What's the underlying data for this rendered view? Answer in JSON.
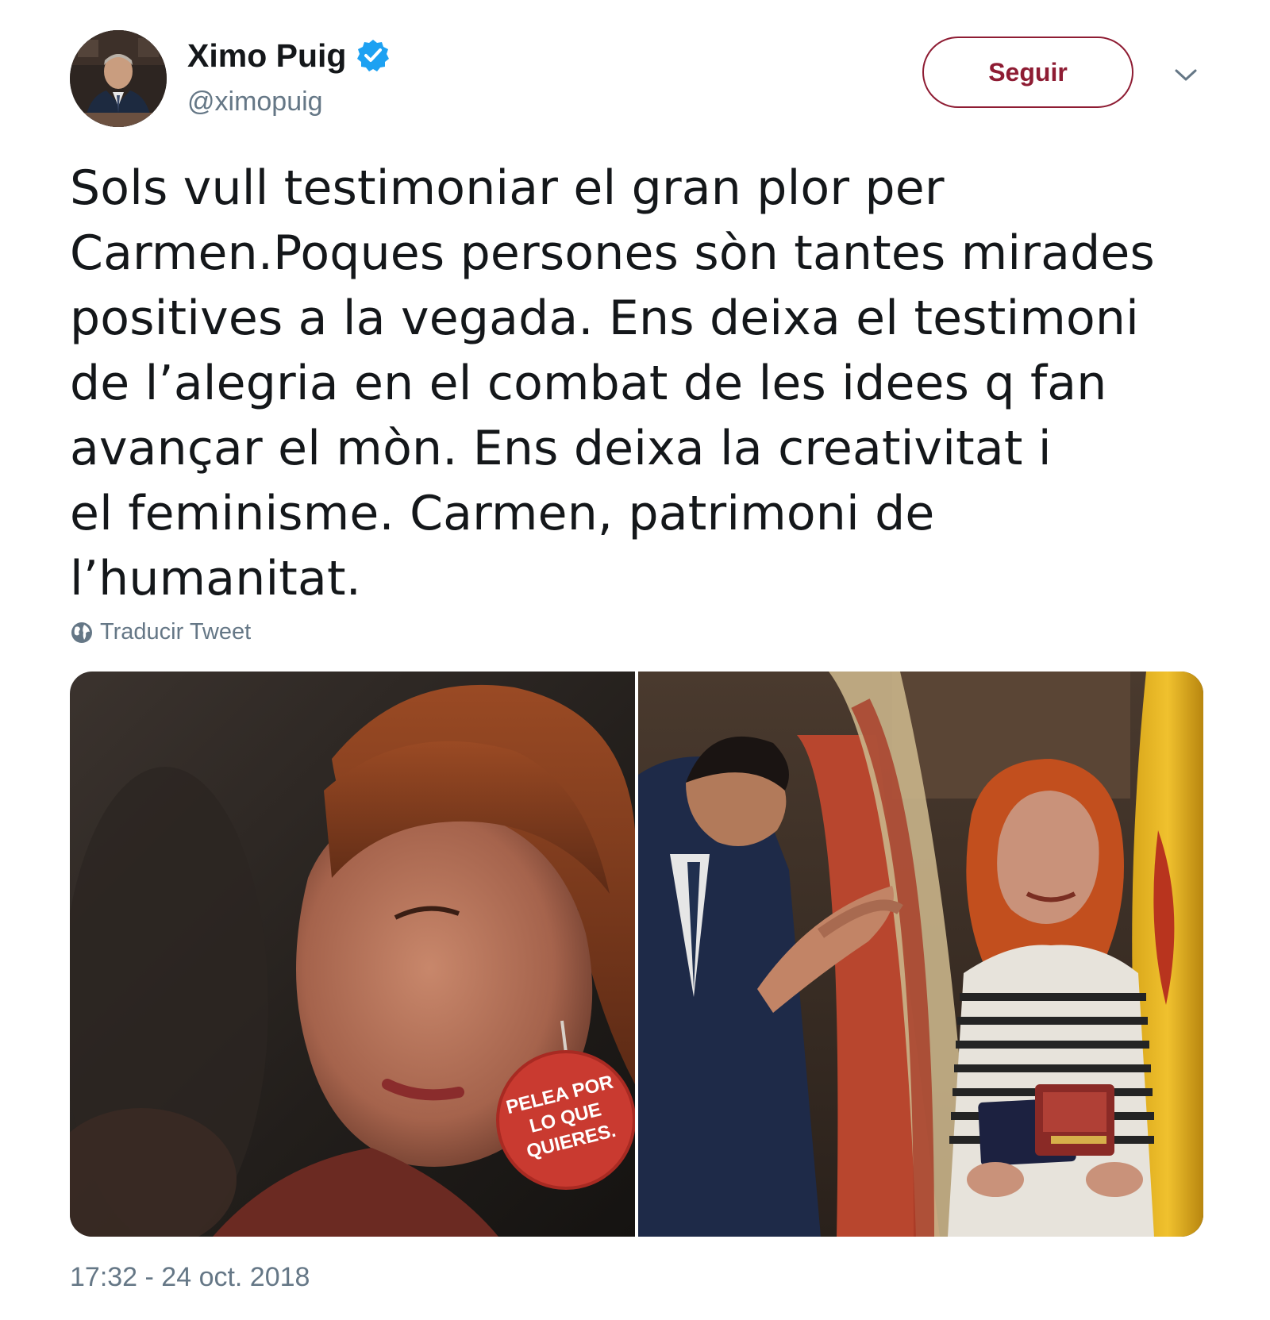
{
  "author": {
    "name": "Ximo Puig",
    "handle": "@ximopuig",
    "verified": true,
    "avatar_icon": "user-avatar-photo"
  },
  "follow_button": {
    "label": "Seguir",
    "color": "#8e1c33"
  },
  "menu_icon": "chevron-down-icon",
  "tweet": {
    "lines": [
      "Sols vull testimoniar el gran plor per",
      "Carmen.Poques persones sòn tantes mirades",
      "positives a la vegada. Ens deixa el testimoni",
      "de l’alegria en el combat de les idees q fan",
      "avançar el mòn. Ens deixa la creativitat i",
      "el feminisme. Carmen, patrimoni de",
      "l’humanitat."
    ],
    "translate_label": "Traducir Tweet",
    "timestamp": "17:32 - 24 oct. 2018"
  },
  "media": {
    "photos": [
      {
        "name": "photo-woman-with-badge",
        "badge_text": [
          "PELEA POR",
          "LO QUE",
          "QUIERES."
        ]
      },
      {
        "name": "photo-award-ceremony"
      }
    ]
  },
  "colors": {
    "text": "#14171a",
    "secondary": "#657786",
    "verified": "#1da1f2"
  }
}
